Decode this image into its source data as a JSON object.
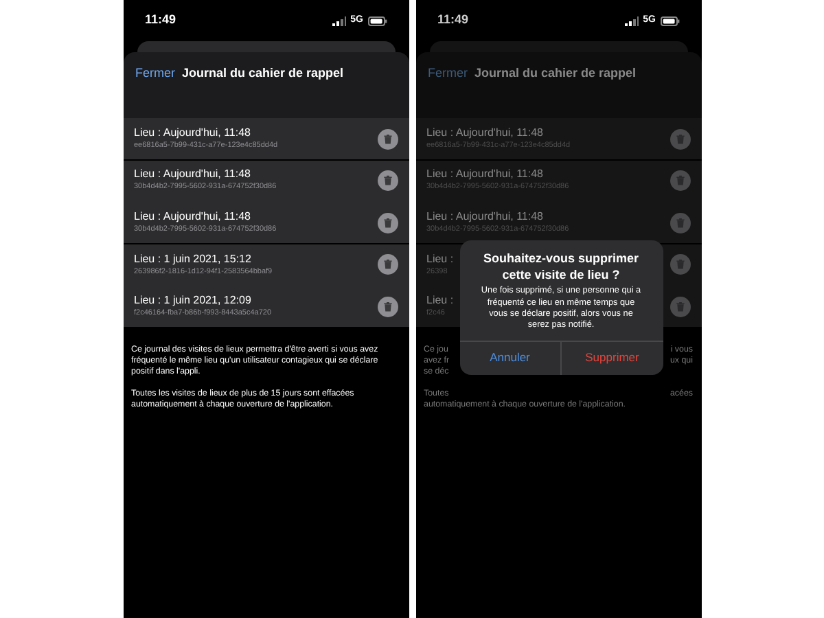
{
  "screens": [
    {
      "dimmed": false,
      "status_bar": {
        "time": "11:49",
        "network": "5G"
      },
      "header": {
        "close": "Fermer",
        "title": "Journal du cahier de rappel"
      },
      "visits": [
        {
          "title": "Lieu : Aujourd'hui, 11:48",
          "id": "ee6816a5-7b99-431c-a77e-123e4c85dd4d"
        },
        {
          "title": "Lieu : Aujourd'hui, 11:48",
          "id": "30b4d4b2-7995-5602-931a-674752f30d86"
        },
        {
          "title": "Lieu : Aujourd'hui, 11:48",
          "id": "30b4d4b2-7995-5602-931a-674752f30d86"
        },
        {
          "title": "Lieu : 1 juin 2021, 15:12",
          "id": "263986f2-1816-1d12-94f1-2583564bbaf9"
        },
        {
          "title": "Lieu : 1 juin 2021, 12:09",
          "id": "f2c46164-fba7-b86b-f993-8443a5c4a720"
        }
      ],
      "footer_lines": [
        {
          "left": "Ce journal des visites de lieux permettra d'être averti si vous avez fréquenté le même lieu qu'un utilisateur contagieux qui se déclare positif dans l'appli."
        },
        {
          "left": "Toutes les visites de lieux de plus de 15 jours sont effacées automatiquement à chaque ouverture de l'application."
        }
      ]
    },
    {
      "dimmed": true,
      "status_bar": {
        "time": "11:49",
        "network": "5G"
      },
      "header": {
        "close": "Fermer",
        "title": "Journal du cahier de rappel"
      },
      "visits": [
        {
          "title": "Lieu : Aujourd'hui, 11:48",
          "id": "ee6816a5-7b99-431c-a77e-123e4c85dd4d"
        },
        {
          "title": "Lieu : Aujourd'hui, 11:48",
          "id": "30b4d4b2-7995-5602-931a-674752f30d86"
        },
        {
          "title": "Lieu : Aujourd'hui, 11:48",
          "id": "30b4d4b2-7995-5602-931a-674752f30d86"
        },
        {
          "title": "Lieu :",
          "id": "26398"
        },
        {
          "title": "Lieu :",
          "id": "f2c46"
        }
      ],
      "footer_lines": [
        {
          "left": "Ce jou",
          "right": "i vous"
        },
        {
          "left": "avez fr",
          "right": "ux qui"
        },
        {
          "left": "se déc"
        },
        {
          "left": "Toutes",
          "right": "acées"
        },
        {
          "left": "automatiquement à chaque ouverture de l'application."
        }
      ],
      "dialog": {
        "title": "Souhaitez-vous supprimer cette visite de lieu ?",
        "message": "Une fois supprimé, si une personne qui a fréquenté ce lieu en même temps que vous se déclare positif, alors vous ne serez pas notifié.",
        "buttons": [
          {
            "label": "Annuler",
            "kind": "cancel"
          },
          {
            "label": "Supprimer",
            "kind": "destructive"
          }
        ]
      }
    }
  ]
}
